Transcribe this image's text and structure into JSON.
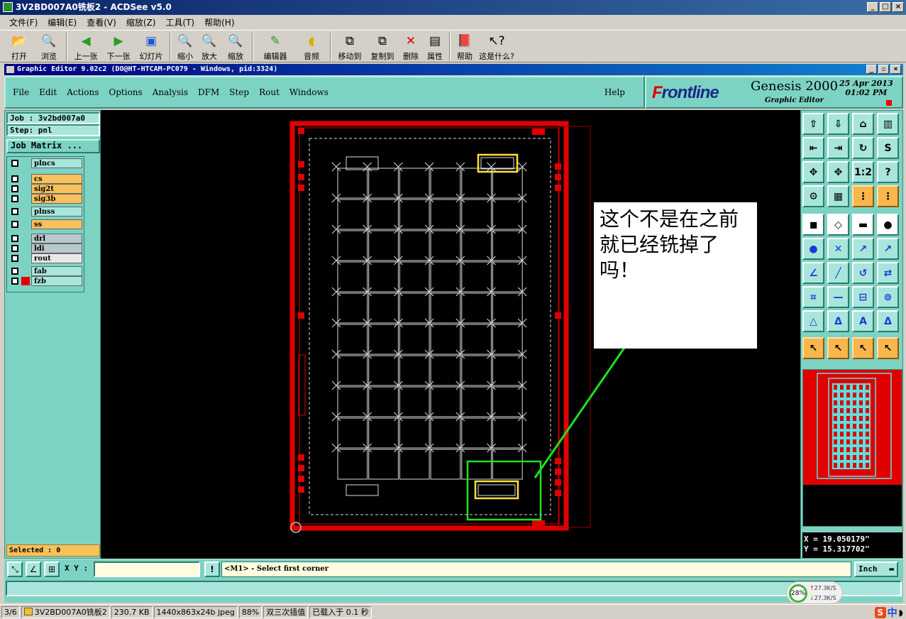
{
  "acdsee": {
    "title": "3V2BD007A0铣板2 - ACDSee v5.0",
    "menu": [
      "文件(F)",
      "编辑(E)",
      "查看(V)",
      "缩放(Z)",
      "工具(T)",
      "帮助(H)"
    ],
    "toolbar": {
      "open": "打开",
      "browse": "浏览",
      "prev": "上一张",
      "next": "下一张",
      "slideshow": "幻灯片",
      "zoom_out": "缩小",
      "zoom_in": "放大",
      "zoom": "缩放",
      "editor": "编辑器",
      "audio": "音频",
      "move_to": "移动到",
      "copy_to": "复制到",
      "delete": "删除",
      "properties": "属性",
      "help": "帮助",
      "whats_this": "这是什么?"
    },
    "status": {
      "index": "3/6",
      "filename": "3V2BD007A0铣板2",
      "size": "230.7 KB",
      "dims": "1440x863x24b jpeg",
      "zoom": "88%",
      "interp": "双三次插值",
      "load": "已载入于 0.1 秒"
    }
  },
  "genesis": {
    "window_title": "Graphic Editor 9.02c2 (DO@HT-HTCAM-PC079 - Windows, pid:3324)",
    "menu": [
      "File",
      "Edit",
      "Actions",
      "Options",
      "Analysis",
      "DFM",
      "Step",
      "Rout",
      "Windows"
    ],
    "help": "Help",
    "logo": {
      "brand_a": "F",
      "brand_b": "rontline",
      "product": "Genesis 2000",
      "subtitle": "Graphic Editor",
      "date": "25 Apr 2013",
      "time": "01:02 PM"
    },
    "job": "Job : 3v2bd007a0",
    "step": "Step: pnl",
    "job_matrix": "Job Matrix ...",
    "layers": [
      {
        "name": "plncs",
        "color": "#a8e6dc"
      },
      {
        "name": "cs",
        "color": "#f8c15c"
      },
      {
        "name": "sig2t",
        "color": "#f8c15c"
      },
      {
        "name": "sig3b",
        "color": "#f8c15c"
      },
      {
        "name": "plnss",
        "color": "#a8e6dc"
      },
      {
        "name": "ss",
        "color": "#f8c15c"
      },
      {
        "name": "drl",
        "color": "#b8c8cc"
      },
      {
        "name": "ldi",
        "color": "#b8c8cc"
      },
      {
        "name": "rout",
        "color": "#e8e8e8"
      },
      {
        "name": "fab",
        "color": "#a8e6dc"
      },
      {
        "name": "fzb",
        "color": "#a8e6dc"
      }
    ],
    "selected": "Selected : 0",
    "annotation": "这个不是在之前就已经铣掉了吗！",
    "coord_x": "X =  19.050179\"",
    "coord_y": "Y =  15.317702\"",
    "xy_label": "X Y :",
    "xy_value": "",
    "prompt": "<M1> - Select first corner",
    "unit": "Inch",
    "netmon": {
      "pct": "28%",
      "up": "27.3K/S",
      "down": "27.3K/S"
    }
  }
}
